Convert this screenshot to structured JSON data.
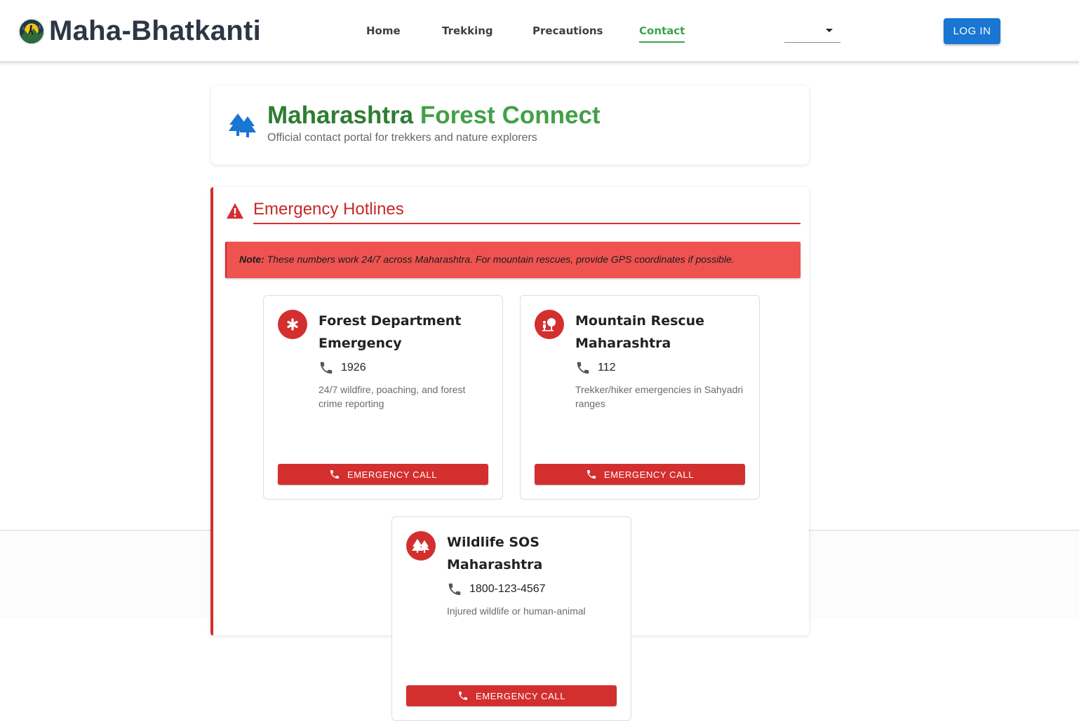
{
  "brand": {
    "name": "Maha-Bhatkanti",
    "logo": "mountain-trekker-logo"
  },
  "nav": {
    "items": [
      {
        "label": "Home",
        "active": false
      },
      {
        "label": "Trekking",
        "active": false
      },
      {
        "label": "Precautions",
        "active": false
      },
      {
        "label": "Contact",
        "active": true
      }
    ],
    "language_select": {
      "value": ""
    },
    "login_label": "LOG IN"
  },
  "header": {
    "icon": "forest-trees-icon",
    "title_part1": "Maharashtra",
    "title_part2": "Forest Connect",
    "subtitle": "Official contact portal for trekkers and nature explorers"
  },
  "emergency": {
    "icon": "warning-icon",
    "title": "Emergency Hotlines",
    "note_label": "Note:",
    "note_text": " These numbers work 24/7 across Maharashtra. For mountain rescues, provide GPS coordinates if possible.",
    "hotlines": [
      {
        "icon": "medical-asterisk-icon",
        "title": "Forest Department Emergency",
        "phone": "1926",
        "description": "24/7 wildfire, poaching, and forest crime reporting",
        "button": "EMERGENCY CALL"
      },
      {
        "icon": "hiker-icon",
        "title": "Mountain Rescue Maharashtra",
        "phone": "112",
        "description": "Trekker/hiker emergencies in Sahyadri ranges",
        "button": "EMERGENCY CALL"
      },
      {
        "icon": "forest-icon",
        "title": "Wildlife SOS Maharashtra",
        "phone": "1800-123-4567",
        "description": "Injured wildlife or human-animal",
        "button": "EMERGENCY CALL"
      }
    ]
  },
  "colors": {
    "accent_green": "#43a047",
    "dark_green": "#2e7d32",
    "emergency_red": "#d32f2f",
    "note_red": "#ef5350",
    "login_blue": "#1976d2"
  }
}
